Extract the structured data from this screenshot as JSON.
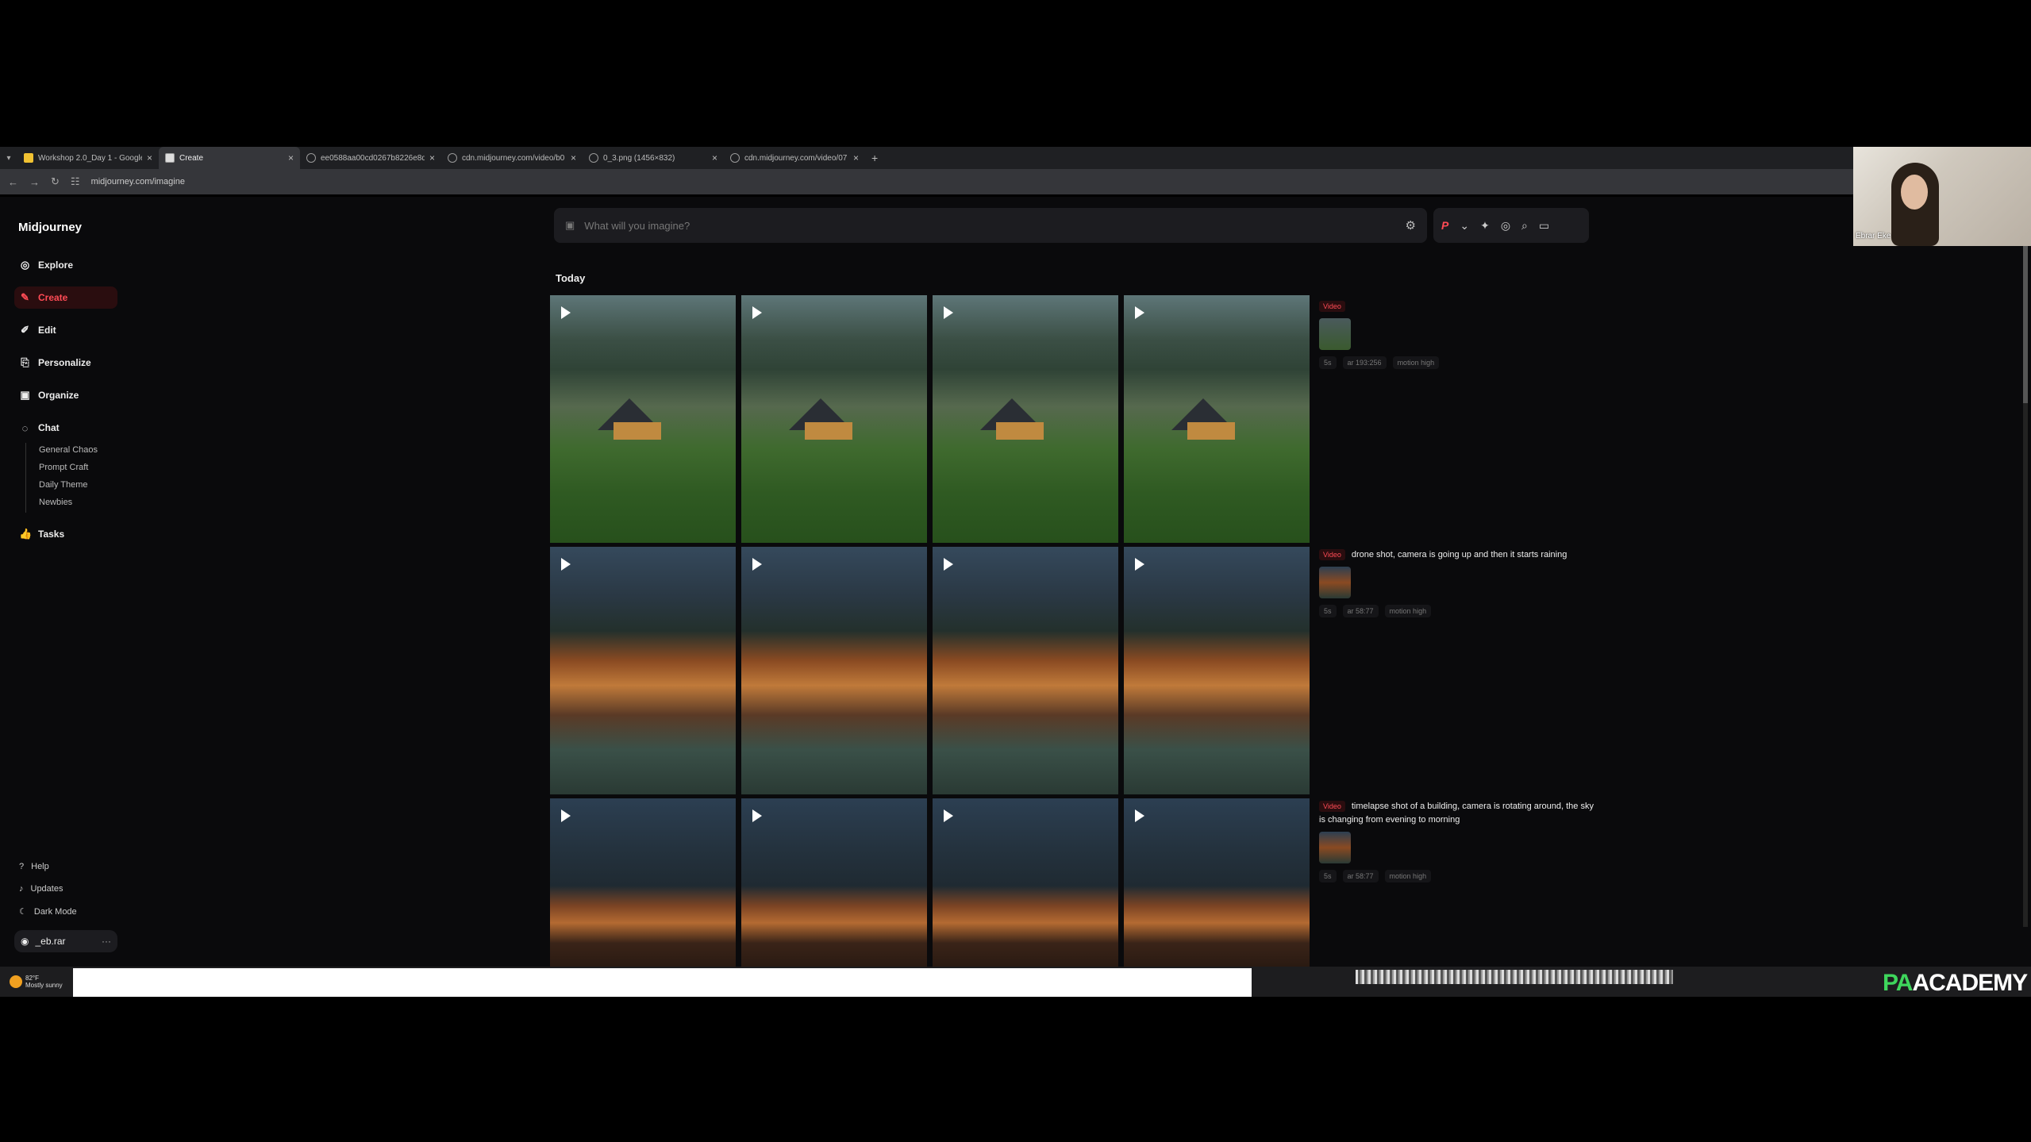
{
  "browser": {
    "tabs": [
      {
        "label": "Workshop 2.0_Day 1 - Google",
        "active": false,
        "favicon": "sheets-icon"
      },
      {
        "label": "Create",
        "active": true,
        "favicon": "midjourney-icon"
      },
      {
        "label": "ee0588aa00cd0267b8226e8d1",
        "active": false,
        "favicon": "globe-icon"
      },
      {
        "label": "cdn.midjourney.com/video/b0",
        "active": false,
        "favicon": "globe-icon"
      },
      {
        "label": "0_3.png (1456×832)",
        "active": false,
        "favicon": "globe-icon"
      },
      {
        "label": "cdn.midjourney.com/video/07",
        "active": false,
        "favicon": "globe-icon"
      }
    ],
    "url": "midjourney.com/imagine"
  },
  "sidebar": {
    "brand": "Midjourney",
    "items": [
      {
        "label": "Explore",
        "icon": "compass-icon",
        "active": false
      },
      {
        "label": "Create",
        "icon": "brush-icon",
        "active": true
      },
      {
        "label": "Edit",
        "icon": "edit-icon",
        "active": false
      },
      {
        "label": "Personalize",
        "icon": "personalize-icon",
        "active": false
      },
      {
        "label": "Organize",
        "icon": "organize-icon",
        "active": false
      },
      {
        "label": "Chat",
        "icon": "chat-icon",
        "active": false
      }
    ],
    "chat_rooms": [
      "General Chaos",
      "Prompt Craft",
      "Daily Theme",
      "Newbies"
    ],
    "tasks": "Tasks",
    "footer": [
      {
        "label": "Help",
        "icon": "help-icon"
      },
      {
        "label": "Updates",
        "icon": "bell-icon"
      },
      {
        "label": "Dark Mode",
        "icon": "moon-icon"
      }
    ],
    "user": "_eb.rar"
  },
  "search": {
    "placeholder": "What will you imagine?"
  },
  "toolbar": {
    "personalize_label": "P"
  },
  "section_title": "Today",
  "jobs": [
    {
      "tag": "Video",
      "prompt": "",
      "chips": [
        "5s",
        "ar 193:256",
        "motion high"
      ]
    },
    {
      "tag": "Video",
      "prompt": "drone shot, camera is going up and then it starts raining",
      "chips": [
        "5s",
        "ar 58:77",
        "motion high"
      ]
    },
    {
      "tag": "Video",
      "prompt": "timelapse shot of a building, camera is rotating around, the sky is changing from evening to morning",
      "chips": [
        "5s",
        "ar 58:77",
        "motion high"
      ]
    }
  ],
  "webcam": {
    "name": "Ebrar Eke"
  },
  "taskbar": {
    "weather_temp": "82°F",
    "weather_desc": "Mostly sunny"
  },
  "watermark": {
    "part1": "PA",
    "part2": "ACADEMY"
  }
}
